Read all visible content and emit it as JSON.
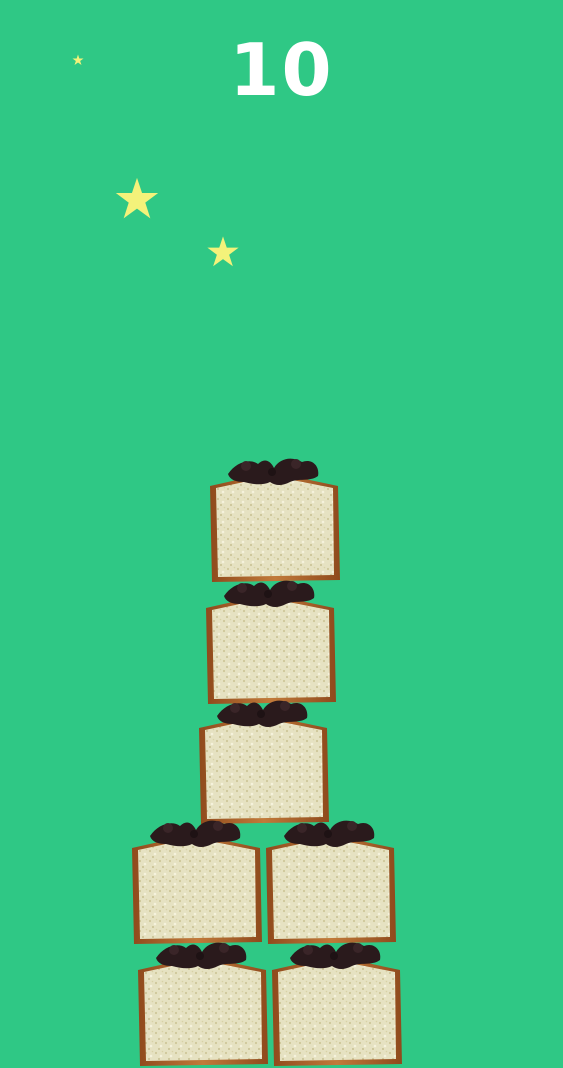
{
  "hud": {
    "score": "10"
  },
  "colors": {
    "background": "#2fc885",
    "score_text": "#ffffff",
    "star": "#f4f27a",
    "cake_crumb": "#e6e2c2",
    "cake_crust": "#b56a2c",
    "chocolate_topping": "#2a1a1c"
  },
  "scene": {
    "stars": [
      {
        "kind": "star",
        "icon": "star-icon"
      },
      {
        "kind": "star",
        "icon": "star-icon"
      },
      {
        "kind": "star",
        "icon": "star-icon"
      }
    ],
    "cake_blocks": [
      {
        "icon": "cake-slice-icon"
      },
      {
        "icon": "cake-slice-icon"
      },
      {
        "icon": "cake-slice-icon"
      },
      {
        "icon": "cake-slice-icon"
      },
      {
        "icon": "cake-slice-icon"
      },
      {
        "icon": "cake-slice-icon"
      },
      {
        "icon": "cake-slice-icon"
      }
    ]
  }
}
